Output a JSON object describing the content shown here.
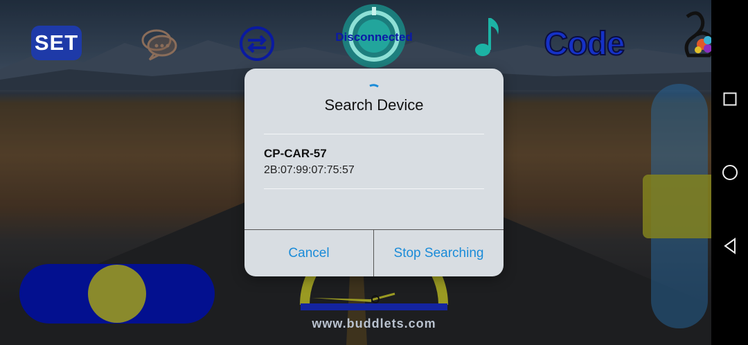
{
  "toolbar": {
    "set_label": "SET",
    "status_text": "Disconnected",
    "code_label": "Code"
  },
  "dialog": {
    "title": "Search Device",
    "devices": [
      {
        "name": "CP-CAR-57",
        "mac": "2B:07:99:07:75:57"
      }
    ],
    "cancel_label": "Cancel",
    "stop_label": "Stop Searching"
  },
  "footer": {
    "url": "www.buddlets.com"
  },
  "icons": {
    "chat": "chat-bubbles-icon",
    "swap": "swap-arrows-icon",
    "status": "connection-ring-icon",
    "music": "music-note-icon",
    "logo": "swan-logo-icon",
    "spinner": "loading-spinner-icon",
    "nav_recent": "square-icon",
    "nav_home": "circle-icon",
    "nav_back": "triangle-back-icon"
  },
  "colors": {
    "accent_blue": "#1a8bd8",
    "toggle_track": "#03108f",
    "toggle_knob": "#8a8a2c",
    "status_text": "#0b1aa6"
  },
  "controls": {
    "toggle_position": "right"
  }
}
